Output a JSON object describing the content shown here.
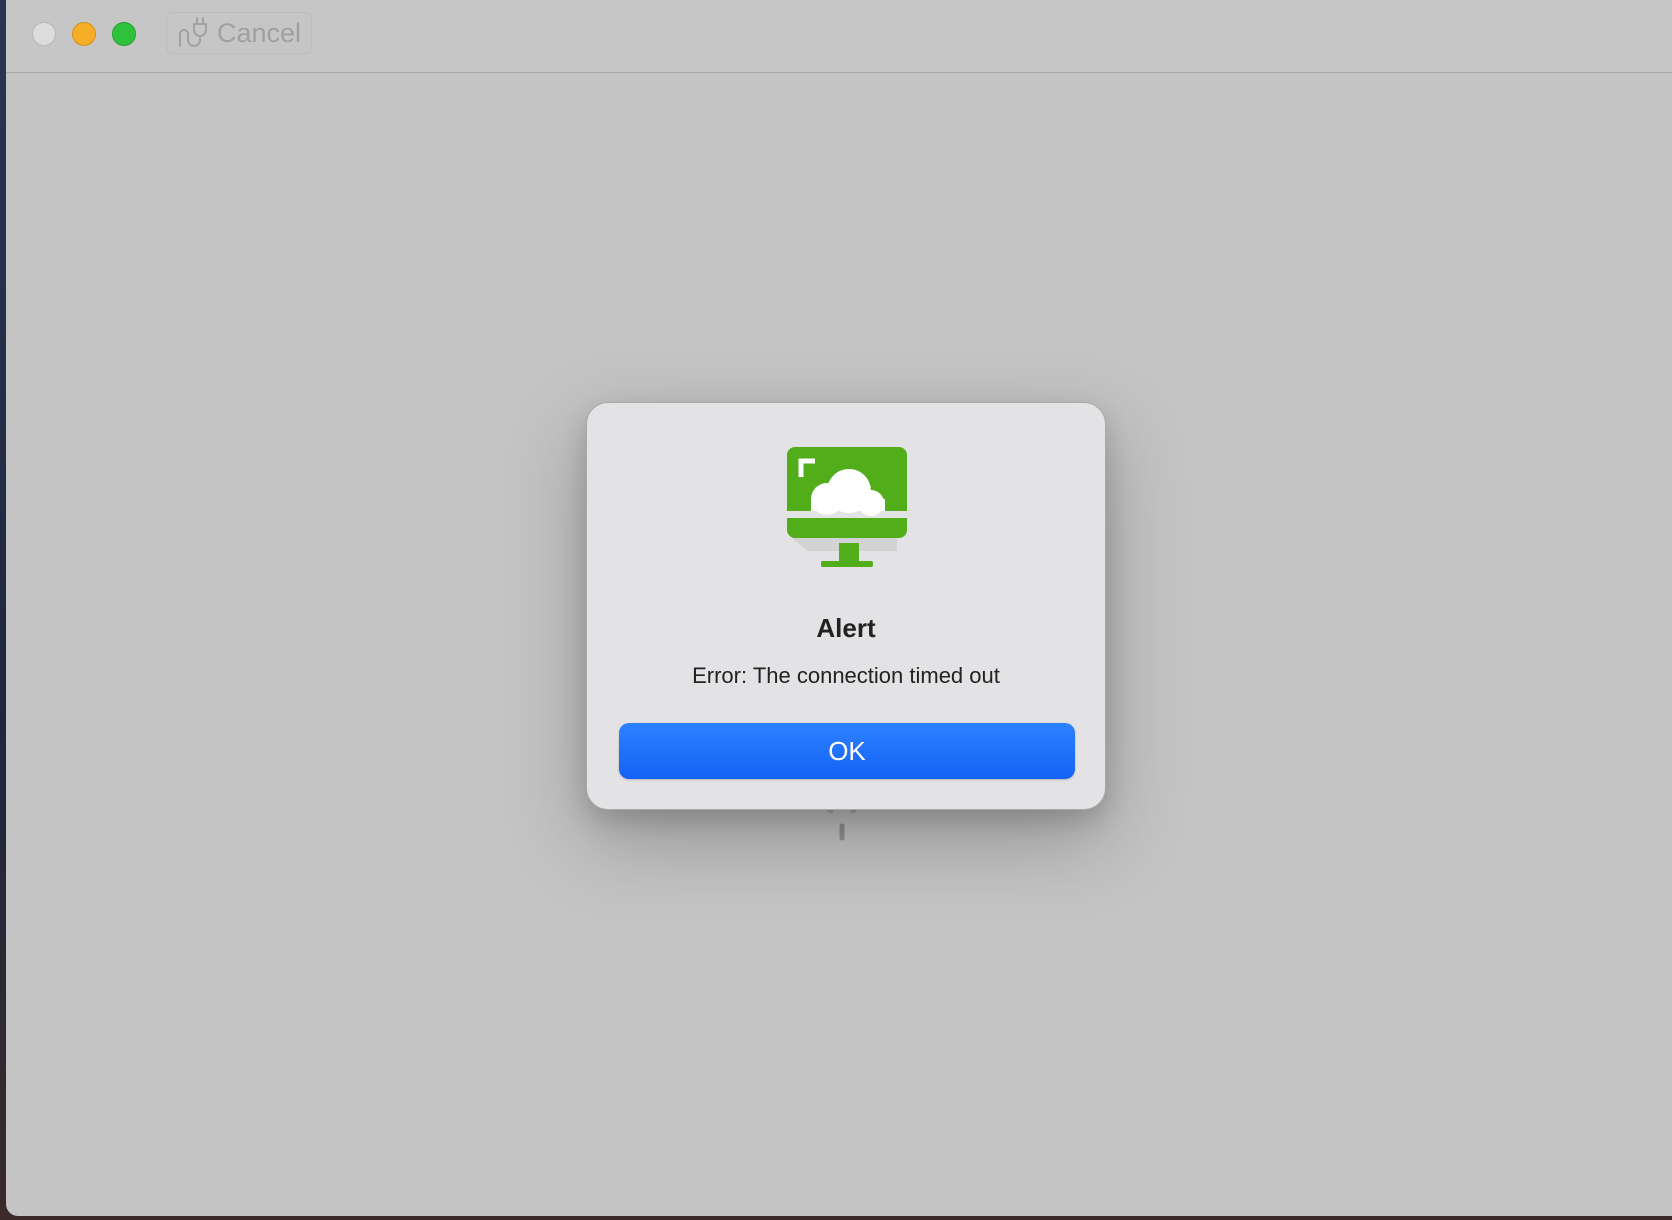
{
  "toolbar": {
    "cancel_label": "Cancel",
    "cancel_icon": "plug-disconnect-icon"
  },
  "window_controls": {
    "close_color": "#dcdcdc",
    "minimize_color": "#f5ae25",
    "zoom_color": "#2ec13c"
  },
  "alert": {
    "icon": "remote-desktop-cloud-icon",
    "icon_color": "#52ad1b",
    "title": "Alert",
    "message": "Error: The connection timed out",
    "ok_label": "OK",
    "ok_color": "#1a6cff"
  }
}
